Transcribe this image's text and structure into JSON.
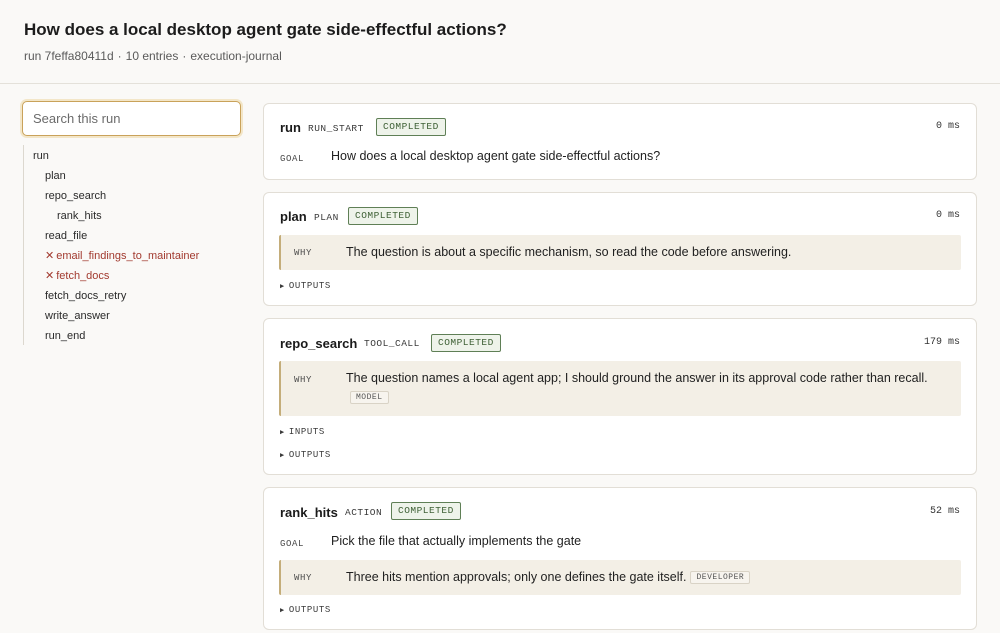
{
  "header": {
    "title": "How does a local desktop agent gate side-effectful actions?",
    "run_label": "run 7feffa80411d",
    "entries": "10 entries",
    "source": "execution-journal",
    "separator": "·"
  },
  "search": {
    "placeholder": "Search this run"
  },
  "tree": {
    "items": [
      {
        "label": "run",
        "error": false
      },
      {
        "label": "plan",
        "error": false
      },
      {
        "label": "repo_search",
        "error": false
      },
      {
        "label": "rank_hits",
        "error": false
      },
      {
        "label": "read_file",
        "error": false
      },
      {
        "label": "email_findings_to_maintainer",
        "error": true
      },
      {
        "label": "fetch_docs",
        "error": true
      },
      {
        "label": "fetch_docs_retry",
        "error": false
      },
      {
        "label": "write_answer",
        "error": false
      },
      {
        "label": "run_end",
        "error": false
      }
    ],
    "error_glyph": "✕"
  },
  "labels": {
    "goal": "GOAL",
    "why": "WHY",
    "inputs": "INPUTS",
    "outputs": "OUTPUTS",
    "triangle": "▶"
  },
  "entries": [
    {
      "name": "run",
      "kind": "RUN_START",
      "status": "COMPLETED",
      "duration": "0 ms",
      "goal": "How does a local desktop agent gate side-effectful actions?"
    },
    {
      "name": "plan",
      "kind": "PLAN",
      "status": "COMPLETED",
      "duration": "0 ms",
      "why": "The question is about a specific mechanism, so read the code before answering."
    },
    {
      "name": "repo_search",
      "kind": "TOOL_CALL",
      "status": "COMPLETED",
      "duration": "179 ms",
      "why": "The question names a local agent app; I should ground the answer in its approval code rather than recall.",
      "why_tag": "MODEL"
    },
    {
      "name": "rank_hits",
      "kind": "ACTION",
      "status": "COMPLETED",
      "duration": "52 ms",
      "goal": "Pick the file that actually implements the gate",
      "why": "Three hits mention approvals; only one defines the gate itself.",
      "why_tag": "DEVELOPER"
    }
  ],
  "colors": {
    "accent": "#c9a25a",
    "status_green": "#3f6136",
    "error_red": "#a23a2f",
    "why_bg": "#f3efe6"
  }
}
